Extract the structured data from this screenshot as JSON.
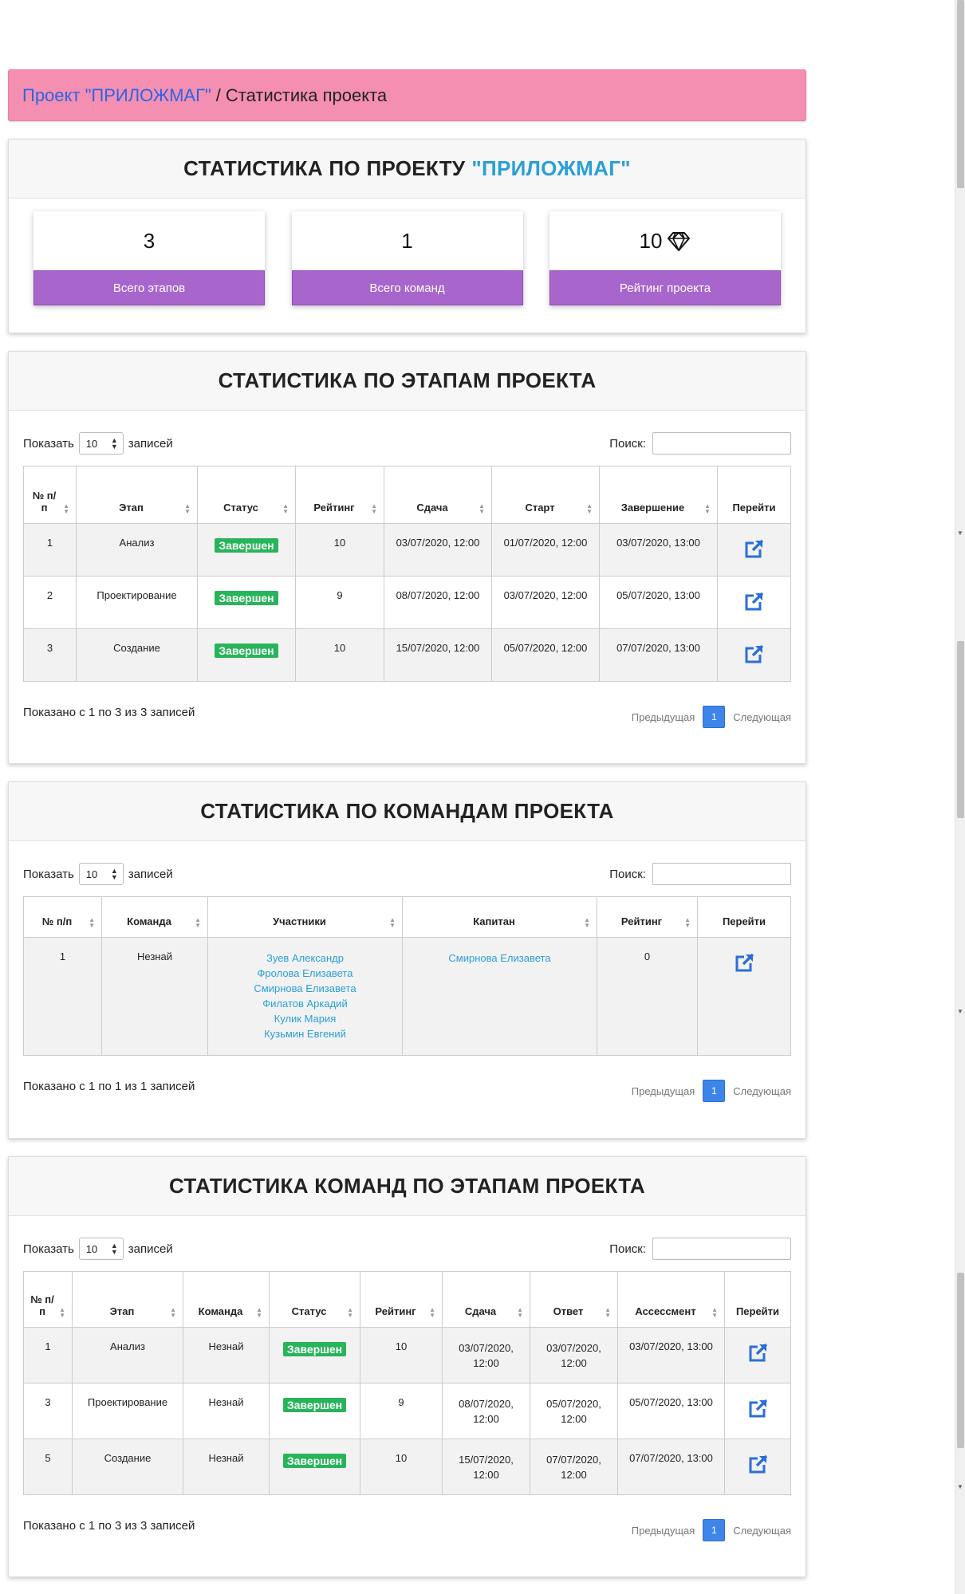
{
  "breadcrumb": {
    "project_link": "Проект \"ПРИЛОЖМАГ\"",
    "separator": "/",
    "current": "Статистика проекта"
  },
  "summary": {
    "title": "СТАТИСТИКА ПО ПРОЕКТУ",
    "project_name": "\"ПРИЛОЖМАГ\"",
    "stats": [
      {
        "value": "3",
        "label": "Всего этапов"
      },
      {
        "value": "1",
        "label": "Всего команд"
      },
      {
        "value": "10",
        "label": "Рейтинг проекта",
        "icon": "diamond-icon"
      }
    ]
  },
  "controls": {
    "show_label": "Показать",
    "page_size": "10",
    "records_label": "записей",
    "search_label": "Поиск:"
  },
  "pager": {
    "prev": "Предыдущая",
    "page": "1",
    "next": "Следующая"
  },
  "stages": {
    "title": "СТАТИСТИКА ПО ЭТАПАМ ПРОЕКТА",
    "columns": [
      "№ п/п",
      "Этап",
      "Статус",
      "Рейтинг",
      "Сдача",
      "Старт",
      "Завершение",
      "Перейти"
    ],
    "rows": [
      {
        "num": "1",
        "stage": "Анализ",
        "status": "Завершен",
        "rating": "10",
        "due": "03/07/2020, 12:00",
        "start": "01/07/2020, 12:00",
        "end": "03/07/2020, 13:00"
      },
      {
        "num": "2",
        "stage": "Проектирование",
        "status": "Завершен",
        "rating": "9",
        "due": "08/07/2020, 12:00",
        "start": "03/07/2020, 12:00",
        "end": "05/07/2020, 13:00"
      },
      {
        "num": "3",
        "stage": "Создание",
        "status": "Завершен",
        "rating": "10",
        "due": "15/07/2020, 12:00",
        "start": "05/07/2020, 12:00",
        "end": "07/07/2020, 13:00"
      }
    ],
    "info": "Показано с 1 по 3 из 3 записей"
  },
  "teams": {
    "title": "СТАТИСТИКА ПО КОМАНДАМ ПРОЕКТА",
    "columns": [
      "№ п/п",
      "Команда",
      "Участники",
      "Капитан",
      "Рейтинг",
      "Перейти"
    ],
    "rows": [
      {
        "num": "1",
        "team": "Незнай",
        "members": [
          "Зуев Александр",
          "Фролова Елизавета",
          "Смирнова Елизавета",
          "Филатов Аркадий",
          "Кулик Мария",
          "Кузьмин Евгений"
        ],
        "captain": "Смирнова Елизавета",
        "rating": "0"
      }
    ],
    "info": "Показано с 1 по 1 из 1 записей"
  },
  "team_stages": {
    "title": "СТАТИСТИКА КОМАНД ПО ЭТАПАМ ПРОЕКТА",
    "columns": [
      "№ п/п",
      "Этап",
      "Команда",
      "Статус",
      "Рейтинг",
      "Сдача",
      "Ответ",
      "Ассессмент",
      "Перейти"
    ],
    "rows": [
      {
        "num": "1",
        "stage": "Анализ",
        "team": "Незнай",
        "status": "Завершен",
        "rating": "10",
        "due": "03/07/2020, 12:00",
        "answer": "03/07/2020, 12:00",
        "assessment": "03/07/2020, 13:00"
      },
      {
        "num": "3",
        "stage": "Проектирование",
        "team": "Незнай",
        "status": "Завершен",
        "rating": "9",
        "due": "08/07/2020, 12:00",
        "answer": "05/07/2020, 12:00",
        "assessment": "05/07/2020, 13:00"
      },
      {
        "num": "5",
        "stage": "Создание",
        "team": "Незнай",
        "status": "Завершен",
        "rating": "10",
        "due": "15/07/2020, 12:00",
        "answer": "07/07/2020, 12:00",
        "assessment": "07/07/2020, 13:00"
      }
    ],
    "info": "Показано с 1 по 3 из 3 записей"
  },
  "colors": {
    "breadcrumb_bg": "#f48fb1",
    "accent_blue": "#2a9fd6",
    "stat_label_bg": "#a866cc",
    "status_badge": "#28b45a",
    "pager_active": "#3d85e8"
  }
}
